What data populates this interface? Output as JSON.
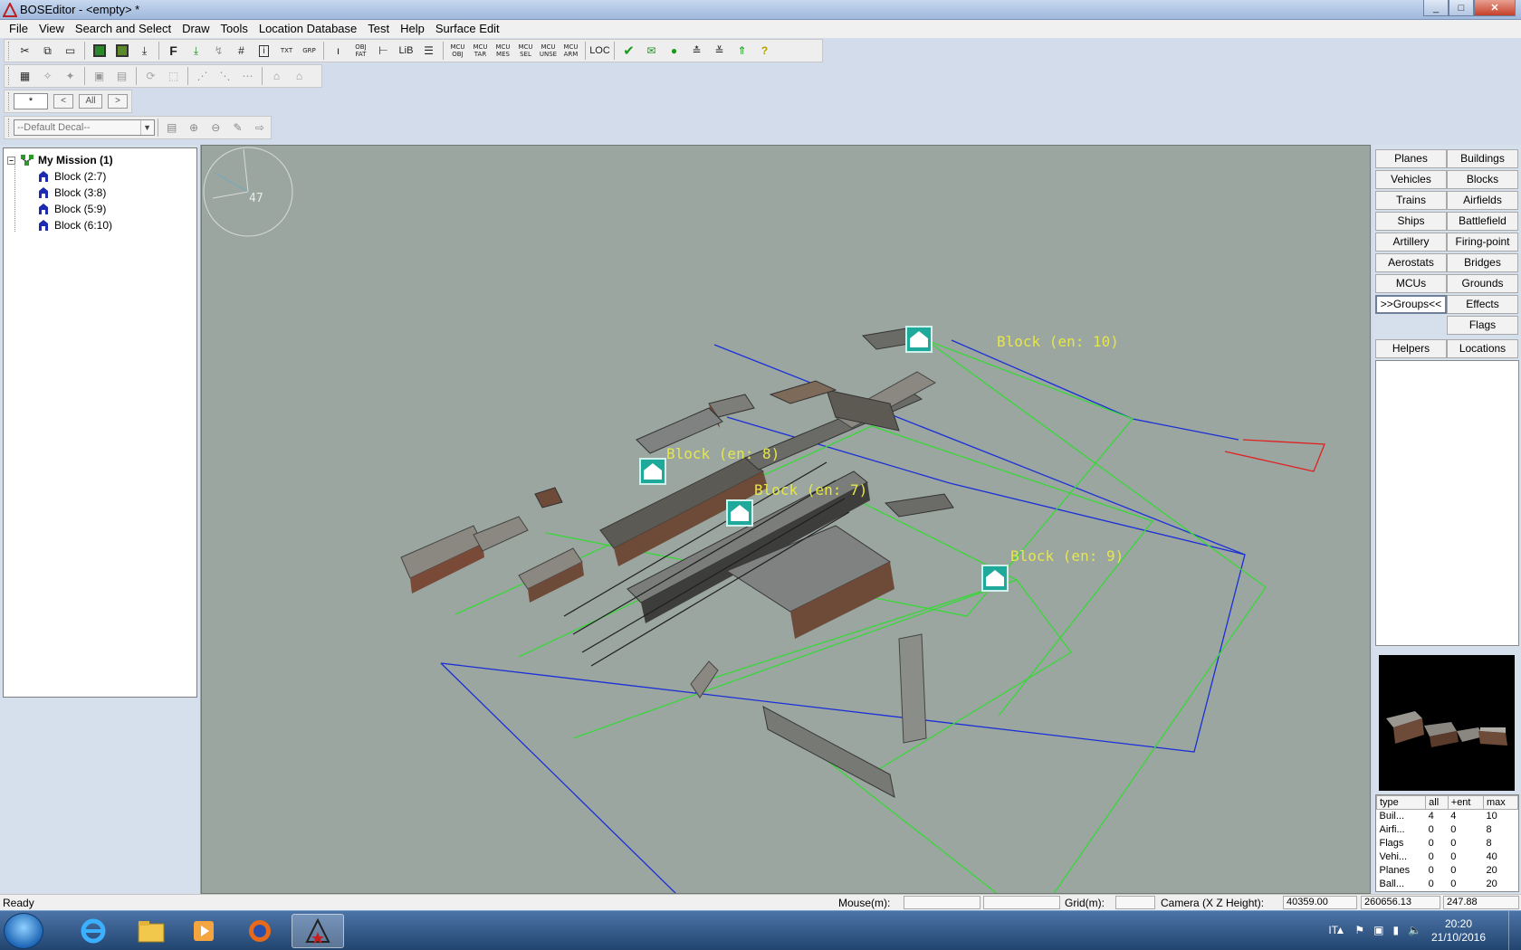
{
  "window": {
    "title": "BOSEditor - <empty> *",
    "min": "_",
    "max": "□",
    "close": "✕"
  },
  "menu": [
    "File",
    "View",
    "Search and Select",
    "Draw",
    "Tools",
    "Location Database",
    "Test",
    "Help",
    "Surface Edit"
  ],
  "toolbar_mini": {
    "txt": "TXT",
    "grp": "GRP",
    "obj_fat": "OBJ FAT",
    "lib": "LiB",
    "mcu_obj": "MCU OBJ",
    "mcu_tar": "MCU TAR",
    "mcu_mes": "MCU MES",
    "mcu_sel": "MCU SEL",
    "mcu_unse": "MCU UNSE",
    "mcu_arm": "MCU ARM",
    "loc": "LOC",
    "f_label": "F"
  },
  "filter": {
    "value": "*",
    "prev": "<",
    "all": "All",
    "next": ">"
  },
  "decal": {
    "selected": "--Default Decal--"
  },
  "tree": {
    "root": "My Mission (1)",
    "children": [
      "Block (2:7)",
      "Block (3:8)",
      "Block (5:9)",
      "Block (6:10)"
    ]
  },
  "viewport": {
    "compass_value": "47",
    "labels": {
      "b10": "Block (en: 10)",
      "b8": "Block (en: 8)",
      "b7": "Block (en: 7)",
      "b9": "Block (en: 9)"
    }
  },
  "categories": {
    "left": [
      "Planes",
      "Vehicles",
      "Trains",
      "Ships",
      "Artillery",
      "Aerostats",
      "MCUs",
      ">>Groups<<",
      "Helpers"
    ],
    "right": [
      "Buildings",
      "Blocks",
      "Airfields",
      "Battlefield",
      "Firing-point",
      "Bridges",
      "Grounds",
      "Effects",
      "Flags",
      "Locations"
    ]
  },
  "stats": {
    "headers": [
      "type",
      "all",
      "+ent",
      "max"
    ],
    "rows": [
      [
        "Buil...",
        "4",
        "4",
        "10"
      ],
      [
        "Airfi...",
        "0",
        "0",
        "8"
      ],
      [
        "Flags",
        "0",
        "0",
        "8"
      ],
      [
        "Vehi...",
        "0",
        "0",
        "40"
      ],
      [
        "Planes",
        "0",
        "0",
        "20"
      ],
      [
        "Ball...",
        "0",
        "0",
        "20"
      ]
    ]
  },
  "status": {
    "ready": "Ready",
    "mouse_label": "Mouse(m):",
    "grid_label": "Grid(m):",
    "camera_label": "Camera (X Z Height):",
    "camera_x": "40359.00",
    "camera_z": "260656.13",
    "camera_h": "247.88"
  },
  "taskbar": {
    "lang": "IT",
    "time": "20:20",
    "date": "21/10/2016"
  },
  "colors": {
    "block_label": "#e6e64a",
    "green_line": "#38d838",
    "blue_line": "#1a2fd6",
    "red_line": "#e02020",
    "marker": "#1fa99a"
  }
}
